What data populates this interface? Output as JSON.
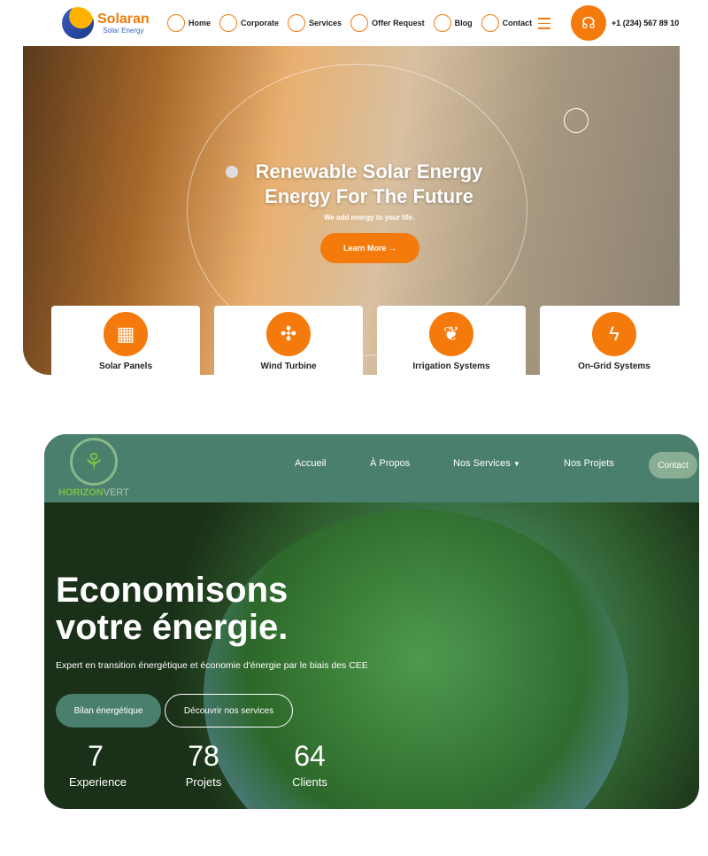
{
  "solaran": {
    "brand": "Solaran",
    "brand_sub": "Solar Energy",
    "menu": [
      {
        "label": "Home"
      },
      {
        "label": "Corporate"
      },
      {
        "label": "Services"
      },
      {
        "label": "Offer Request"
      },
      {
        "label": "Blog"
      },
      {
        "label": "Contact"
      }
    ],
    "phone": "+1 (234) 567 89 10",
    "hero_title_1": "Renewable Solar Energy",
    "hero_title_2": "Energy For The Future",
    "hero_sub": "We add energy to your life.",
    "cta": "Learn More →",
    "accent": "#f47a0c",
    "services": [
      {
        "label": "Solar Panels",
        "icon": "solar-panel-icon"
      },
      {
        "label": "Wind Turbine",
        "icon": "wind-turbine-icon"
      },
      {
        "label": "Irrigation Systems",
        "icon": "irrigation-icon"
      },
      {
        "label": "On-Grid Systems",
        "icon": "on-grid-icon"
      }
    ]
  },
  "horizon": {
    "brand": "HORIZON",
    "brand_2": "VERT",
    "menu": [
      {
        "label": "Accueil"
      },
      {
        "label": "À Propos"
      },
      {
        "label": "Nos Services"
      },
      {
        "label": "Nos Projets"
      }
    ],
    "contact": "Contact",
    "title_1": "Economisons",
    "title_2": "votre énergie.",
    "sub": "Expert en transition énergétique et économie d'énergie par le biais des CEE",
    "btn_primary": "Bilan énergétique",
    "btn_secondary": "Découvrir nos services",
    "stats": [
      {
        "n": "7",
        "l": "Experience"
      },
      {
        "n": "78",
        "l": "Projets"
      },
      {
        "n": "64",
        "l": "Clients"
      }
    ],
    "nav_color": "#4a7f6e"
  }
}
